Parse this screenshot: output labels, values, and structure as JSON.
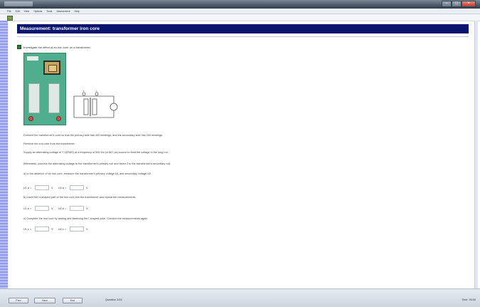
{
  "window": {
    "controls": {
      "minimize_glyph": "–",
      "maximize_glyph": "□",
      "close_glyph": "×"
    }
  },
  "menubar": {
    "items": [
      "File",
      "Edit",
      "View",
      "Options",
      "Tools",
      "Assessment",
      "Help"
    ]
  },
  "header": {
    "title": "Measurement: transformer iron core"
  },
  "intro": {
    "text": "Investigate the effect of an iron core on a transformer."
  },
  "schematic": {
    "label_left": "A",
    "label_right": "A"
  },
  "instructions": [
    "Connect the transformer's coils so that the primary side has 400 windings, and the secondary side has 200 windings.",
    "Remove the iron core from the transformer.",
    "Supply an alternating voltage of 7 V(RMS) at a frequency of 500 Hz (or 667 μs) source to feed the voltage in the long run.",
    "Afterwards, connect the alternating voltage to the transformer's primary coil and factor 2 to the transformer's secondary coil.",
    "a) In the absence of an iron core, measure the transformer's primary voltage U1 and secondary voltage U2."
  ],
  "measurements": [
    {
      "fields": [
        {
          "label": "U1,a =",
          "value": "",
          "unit": "V"
        },
        {
          "label": "U2,a =",
          "value": "",
          "unit": "V"
        }
      ],
      "note": "b) Insert the U-shaped part of the iron core into the transformer and repeat the measurements."
    },
    {
      "fields": [
        {
          "label": "U1,b =",
          "value": "",
          "unit": "V"
        },
        {
          "label": "U2,b =",
          "value": "",
          "unit": "V"
        }
      ],
      "note": "c) Complete the iron core by adding and fastening the I-shaped yoke. Conduct the measurements again."
    },
    {
      "fields": [
        {
          "label": "U1,c =",
          "value": "",
          "unit": "V"
        },
        {
          "label": "U2,c =",
          "value": "",
          "unit": "V"
        }
      ],
      "note": ""
    }
  ],
  "statusbar": {
    "prev_label": "Prev",
    "next_label": "Next",
    "finish_label": "End",
    "question_counter": "Question 3/15",
    "timer": "Time: 35:00"
  },
  "colors": {
    "header_bg": "#09146e",
    "left_strip": "#8f9ae8",
    "photo_bg": "#4fae8e"
  }
}
